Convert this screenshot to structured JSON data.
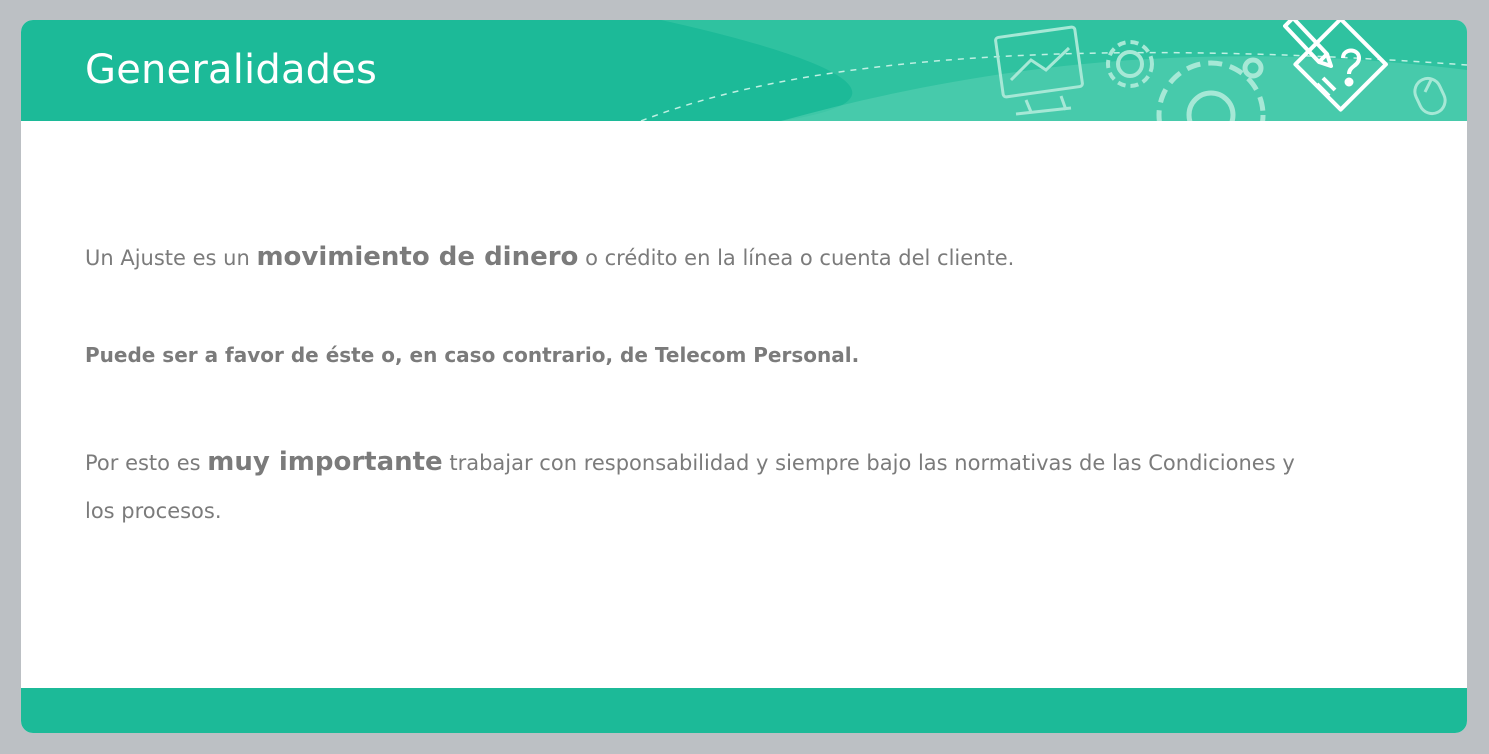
{
  "slide": {
    "title": "Generalidades",
    "paragraph1": {
      "before": "Un Ajuste es un ",
      "emphasis": "movimiento de dinero",
      "after": " o crédito en la línea o cuenta del cliente."
    },
    "paragraph2": "Puede ser a favor de éste o, en caso contrario, de Telecom Personal.",
    "paragraph3": {
      "before": "Por esto es ",
      "emphasis": "muy importante",
      "after": " trabajar con responsabilidad y siempre bajo las normativas de las Condiciones y los procesos."
    }
  },
  "colors": {
    "accent": "#1cba98",
    "text": "#7b7b7b",
    "background": "#bcc0c4"
  },
  "icons": [
    "presentation-board-icon",
    "gear-icon",
    "large-gear-icon",
    "document-pencil-question-icon",
    "mouse-icon"
  ]
}
